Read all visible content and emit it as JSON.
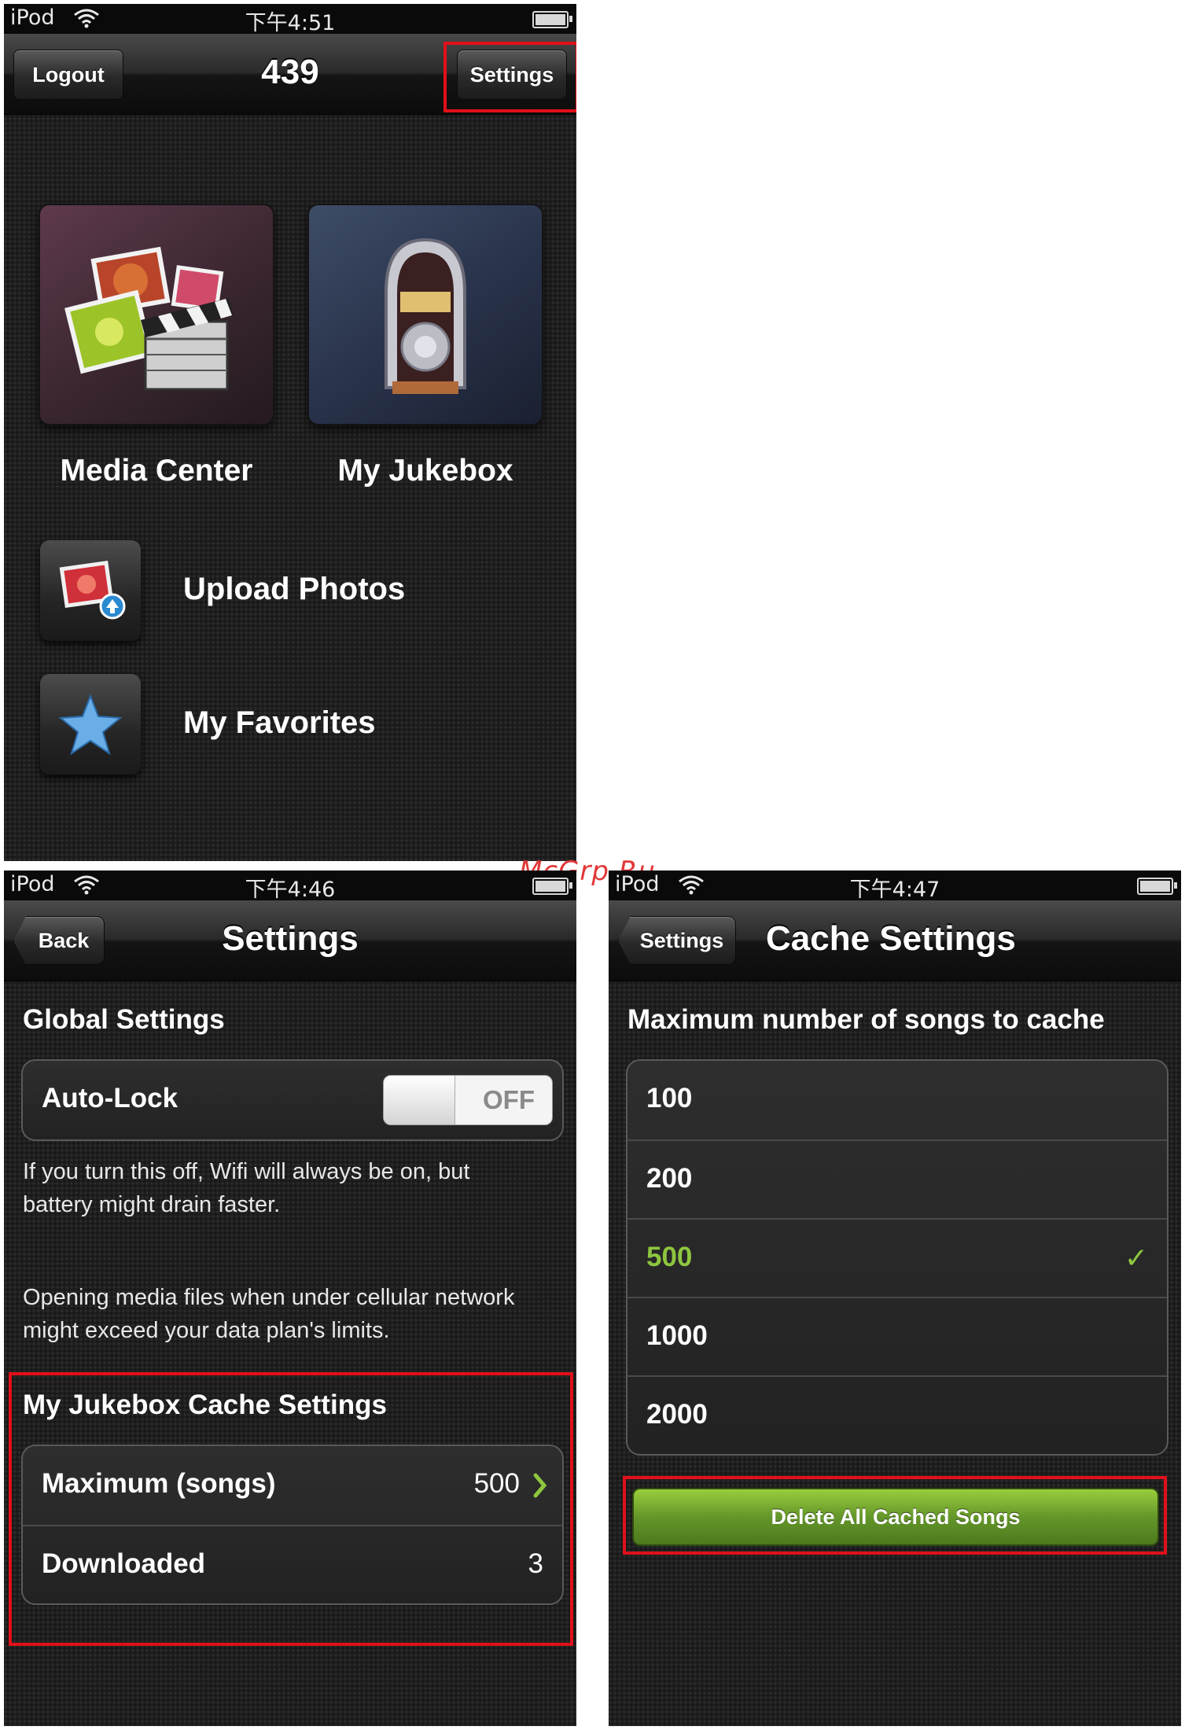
{
  "home_screen": {
    "status": {
      "carrier": "iPod",
      "time": "下午4:51"
    },
    "nav": {
      "logout_label": "Logout",
      "title": "439",
      "settings_label": "Settings"
    },
    "tiles": [
      {
        "label": "Media Center",
        "icon": "media-center-icon"
      },
      {
        "label": "My Jukebox",
        "icon": "jukebox-icon"
      }
    ],
    "rows": [
      {
        "label": "Upload Photos",
        "icon": "upload-photos-icon"
      },
      {
        "label": "My Favorites",
        "icon": "star-icon"
      }
    ]
  },
  "settings_screen": {
    "status": {
      "carrier": "iPod",
      "time": "下午4:46"
    },
    "nav": {
      "back_label": "Back",
      "title": "Settings"
    },
    "global": {
      "header": "Global Settings",
      "autolock_label": "Auto-Lock",
      "autolock_state": "OFF",
      "note1": "If you turn this off, Wifi will always be on, but battery might drain faster.",
      "note2": "Opening media files when under cellular network might exceed your data plan's limits."
    },
    "cache": {
      "header": "My Jukebox Cache Settings",
      "max_label": "Maximum (songs)",
      "max_value": "500",
      "downloaded_label": "Downloaded",
      "downloaded_value": "3"
    }
  },
  "cache_screen": {
    "status": {
      "carrier": "iPod",
      "time": "下午4:47"
    },
    "nav": {
      "back_label": "Settings",
      "title": "Cache Settings"
    },
    "header": "Maximum number of songs to cache",
    "options": [
      "100",
      "200",
      "500",
      "1000",
      "2000"
    ],
    "selected": "500",
    "check_mark": "✓",
    "delete_label": "Delete All Cached Songs"
  },
  "watermark": "McGrp.Ru",
  "colors": {
    "highlight": "#e0101a",
    "selected_text": "#8ec63f",
    "accent_green": "#64962a"
  }
}
